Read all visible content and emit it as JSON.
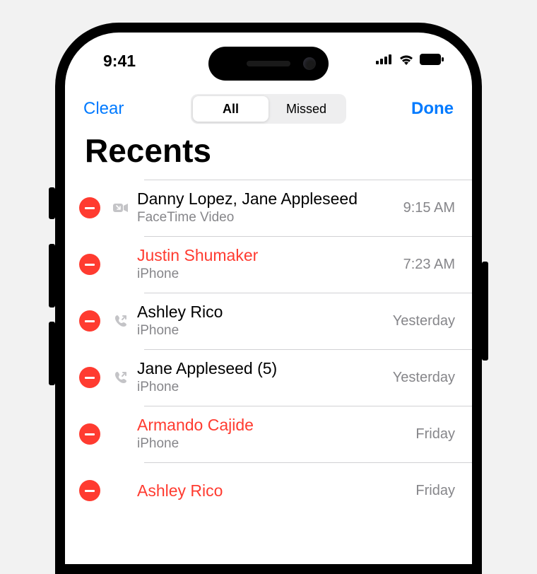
{
  "status": {
    "time": "9:41"
  },
  "nav": {
    "clear": "Clear",
    "done": "Done",
    "segment_all": "All",
    "segment_missed": "Missed"
  },
  "title": "Recents",
  "calls": [
    {
      "name": "Danny Lopez, Jane Appleseed",
      "subtitle": "FaceTime Video",
      "time": "9:15 AM",
      "missed": false,
      "icon": "video"
    },
    {
      "name": "Justin Shumaker",
      "subtitle": "iPhone",
      "time": "7:23 AM",
      "missed": true,
      "icon": "none"
    },
    {
      "name": "Ashley Rico",
      "subtitle": "iPhone",
      "time": "Yesterday",
      "missed": false,
      "icon": "outgoing"
    },
    {
      "name": "Jane Appleseed (5)",
      "subtitle": "iPhone",
      "time": "Yesterday",
      "missed": false,
      "icon": "outgoing"
    },
    {
      "name": "Armando Cajide",
      "subtitle": "iPhone",
      "time": "Friday",
      "missed": true,
      "icon": "none"
    },
    {
      "name": "Ashley Rico",
      "subtitle": "",
      "time": "Friday",
      "missed": true,
      "icon": "none"
    }
  ]
}
